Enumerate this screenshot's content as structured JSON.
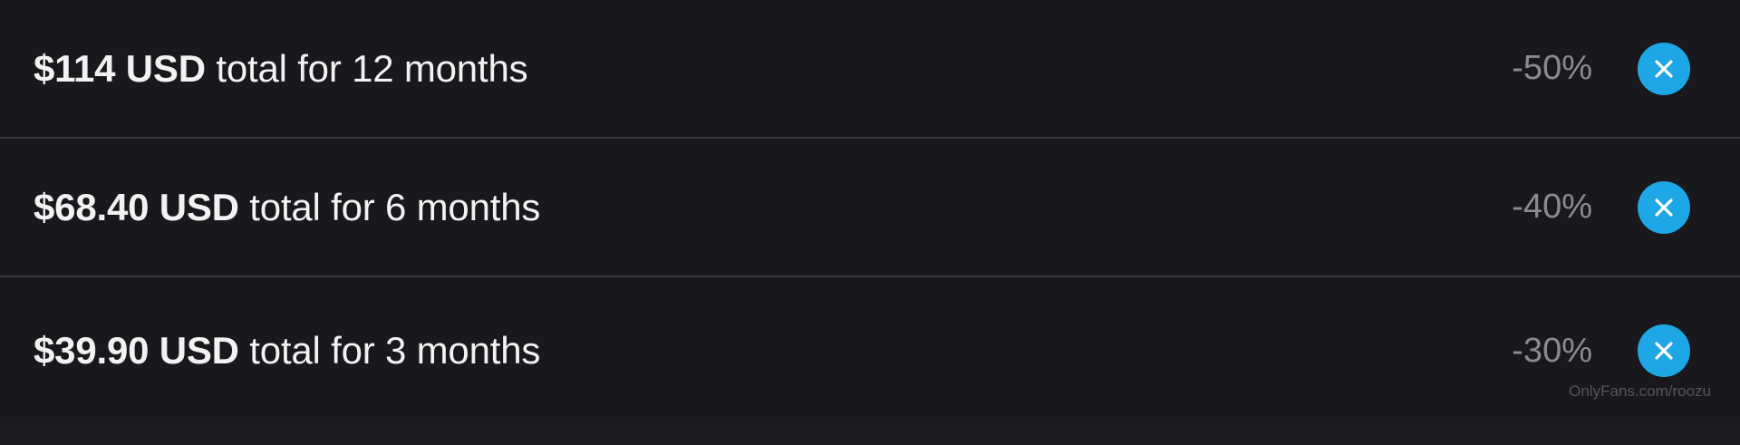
{
  "bundles": [
    {
      "price_bold": "$114 USD",
      "price_rest": " total for 12 months",
      "discount": "-50%",
      "remove_icon": "close-icon"
    },
    {
      "price_bold": "$68.40 USD",
      "price_rest": " total for 6 months",
      "discount": "-40%",
      "remove_icon": "close-icon"
    },
    {
      "price_bold": "$39.90 USD",
      "price_rest": " total for 3 months",
      "discount": "-30%",
      "remove_icon": "close-icon"
    }
  ],
  "watermark": "OnlyFans.com/roozu",
  "colors": {
    "background": "#19181c",
    "divider": "#3a393e",
    "text": "#f2f2f2",
    "discount_text": "#8b8a8f",
    "accent": "#1ea7e6"
  }
}
